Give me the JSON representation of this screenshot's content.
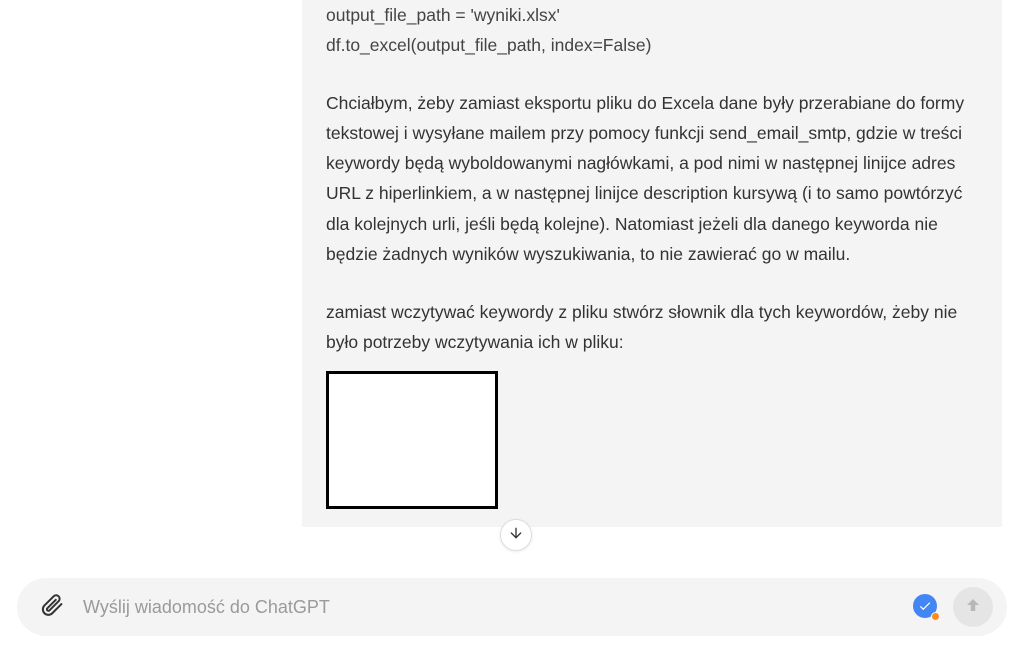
{
  "message": {
    "code_line1": "output_file_path = 'wyniki.xlsx'",
    "code_line2": "df.to_excel(output_file_path, index=False)",
    "para1": "Chciałbym, żeby zamiast eksportu pliku do Excela dane były przerabiane do formy tekstowej i wysyłane mailem przy pomocy funkcji send_email_smtp, gdzie w treści keywordy będą wyboldowanymi nagłówkami, a pod nimi w następnej linijce adres URL z hiperlinkiem, a w następnej linijce description kursywą (i to samo powtórzyć dla kolejnych urli, jeśli będą kolejne). Natomiast jeżeli dla danego keyworda nie będzie żadnych wyników wyszukiwania, to nie zawierać go w mailu.",
    "para2": "zamiast wczytywać keywordy z pliku stwórz słownik dla tych keywordów, żeby nie było potrzeby wczytywania ich w pliku:"
  },
  "composer": {
    "placeholder": "Wyślij wiadomość do ChatGPT"
  },
  "icons": {
    "attach": "attachment-icon",
    "send": "arrow-up-icon",
    "scroll": "arrow-down-icon",
    "badge": "check-icon"
  }
}
